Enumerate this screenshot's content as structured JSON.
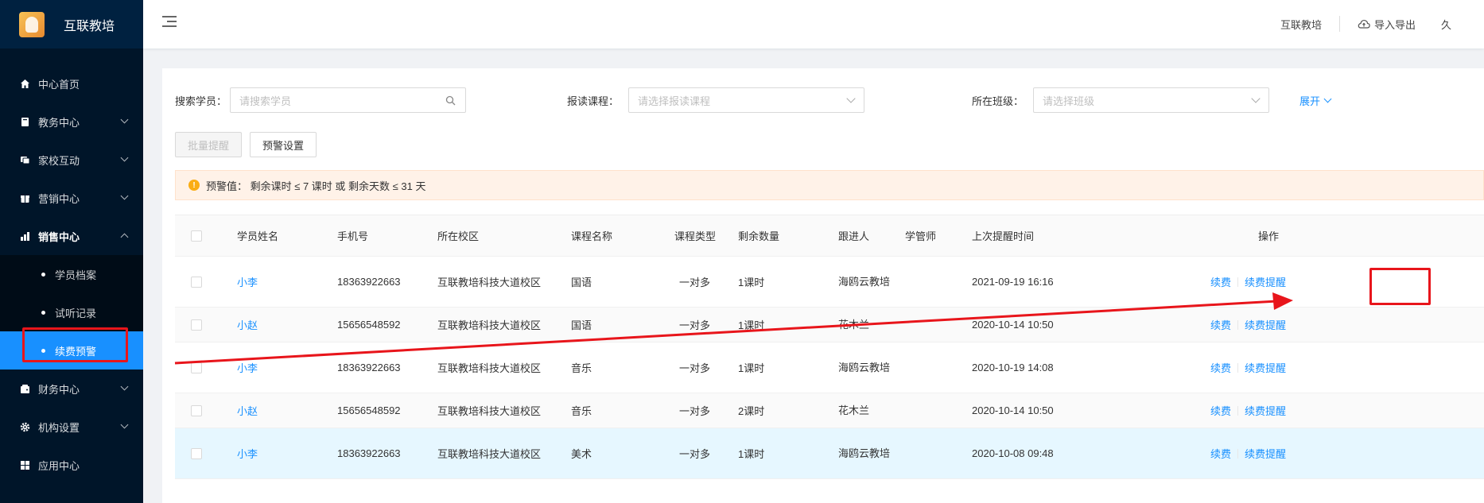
{
  "app": {
    "title": "互联教培"
  },
  "sidebar": {
    "items": [
      {
        "label": "中心首页",
        "icon": "home-icon"
      },
      {
        "label": "教务中心",
        "icon": "book-icon"
      },
      {
        "label": "家校互动",
        "icon": "chat-icon"
      },
      {
        "label": "营销中心",
        "icon": "gift-icon"
      },
      {
        "label": "销售中心",
        "icon": "sales-icon"
      },
      {
        "label": "财务中心",
        "icon": "wallet-icon"
      },
      {
        "label": "机构设置",
        "icon": "gear-icon"
      },
      {
        "label": "应用中心",
        "icon": "grid-icon"
      }
    ],
    "sales_sub": [
      {
        "label": "学员档案"
      },
      {
        "label": "试听记录"
      },
      {
        "label": "续费预警"
      }
    ]
  },
  "header": {
    "org_name": "互联教培",
    "import_export": "导入导出",
    "user_initial": "久"
  },
  "filters": {
    "student_label": "搜索学员：",
    "student_placeholder": "请搜索学员",
    "course_label": "报读课程：",
    "course_placeholder": "请选择报读课程",
    "class_label": "所在班级：",
    "class_placeholder": "请选择班级",
    "expand": "展开"
  },
  "toolbar": {
    "batch_remind": "批量提醒",
    "warn_settings": "预警设置"
  },
  "alert": {
    "text": "预警值： 剩余课时 ≤ 7 课时 或 剩余天数 ≤ 31 天"
  },
  "table": {
    "columns": [
      "学员姓名",
      "手机号",
      "所在校区",
      "课程名称",
      "课程类型",
      "剩余数量",
      "跟进人",
      "学管师",
      "上次提醒时间",
      "操作"
    ],
    "rows": [
      {
        "name": "小李",
        "phone": "18363922663",
        "campus": "互联教培科技大道校区",
        "course": "国语",
        "type": "一对多",
        "remain": "1课时",
        "follower": "海鸥云教培",
        "manager": "",
        "last_remind": "2021-09-19 16:16",
        "op_renew": "续费",
        "op_remind": "续费提醒"
      },
      {
        "name": "小赵",
        "phone": "15656548592",
        "campus": "互联教培科技大道校区",
        "course": "国语",
        "type": "一对多",
        "remain": "1课时",
        "follower": "花木兰",
        "manager": "",
        "last_remind": "2020-10-14 10:50",
        "op_renew": "续费",
        "op_remind": "续费提醒"
      },
      {
        "name": "小李",
        "phone": "18363922663",
        "campus": "互联教培科技大道校区",
        "course": "音乐",
        "type": "一对多",
        "remain": "1课时",
        "follower": "海鸥云教培",
        "manager": "",
        "last_remind": "2020-10-19 14:08",
        "op_renew": "续费",
        "op_remind": "续费提醒"
      },
      {
        "name": "小赵",
        "phone": "15656548592",
        "campus": "互联教培科技大道校区",
        "course": "音乐",
        "type": "一对多",
        "remain": "2课时",
        "follower": "花木兰",
        "manager": "",
        "last_remind": "2020-10-14 10:50",
        "op_renew": "续费",
        "op_remind": "续费提醒"
      },
      {
        "name": "小李",
        "phone": "18363922663",
        "campus": "互联教培科技大道校区",
        "course": "美术",
        "type": "一对多",
        "remain": "1课时",
        "follower": "海鸥云教培",
        "manager": "",
        "last_remind": "2020-10-08 09:48",
        "op_renew": "续费",
        "op_remind": "续费提醒"
      }
    ]
  },
  "colors": {
    "sidebar_bg": "#001529",
    "primary": "#1890ff",
    "annotation_red": "#e8151b",
    "alert_bg": "#fff2e8"
  }
}
